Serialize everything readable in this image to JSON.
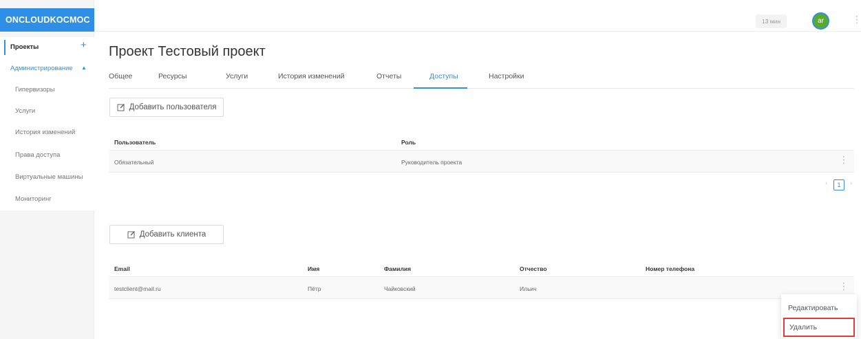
{
  "app": {
    "logo": "ONCLOUDKOCMOC"
  },
  "topbar": {
    "timer": "13 мин",
    "avatar_initials": "ar"
  },
  "sidebar": {
    "projects": "Проекты",
    "admin": "Администрирование",
    "items": [
      "Гипервизоры",
      "Услуги",
      "История изменений",
      "Права доступа",
      "Виртуальные машины",
      "Мониторинг"
    ]
  },
  "main": {
    "title": "Проект Тестовый проект",
    "tabs": [
      "Общее",
      "Ресурсы",
      "Услуги",
      "История изменений",
      "Отчеты",
      "Доступы",
      "Настройки"
    ],
    "active_tab": "Доступы",
    "add_user_label": "Добавить пользователя",
    "users_table": {
      "headers": {
        "user": "Пользователь",
        "role": "Роль"
      },
      "rows": [
        {
          "user": "Обязательный",
          "role": "Руководитель проекта"
        }
      ]
    },
    "pagination": {
      "current": "1"
    },
    "add_client_label": "Добавить клиента",
    "clients_table": {
      "headers": {
        "email": "Email",
        "first_name": "Имя",
        "last_name": "Фамилия",
        "patronymic": "Отчество",
        "phone": "Номер телефона"
      },
      "rows": [
        {
          "email": "testclient@mail.ru",
          "first_name": "Пётр",
          "last_name": "Чайковский",
          "patronymic": "Ильич",
          "phone": ""
        }
      ]
    }
  },
  "context_menu": {
    "edit": "Редактировать",
    "delete": "Удалить"
  },
  "colors": {
    "accent": "#2f8fe6",
    "avatar_bg": "#5aaa2f",
    "highlight": "#e53935"
  }
}
